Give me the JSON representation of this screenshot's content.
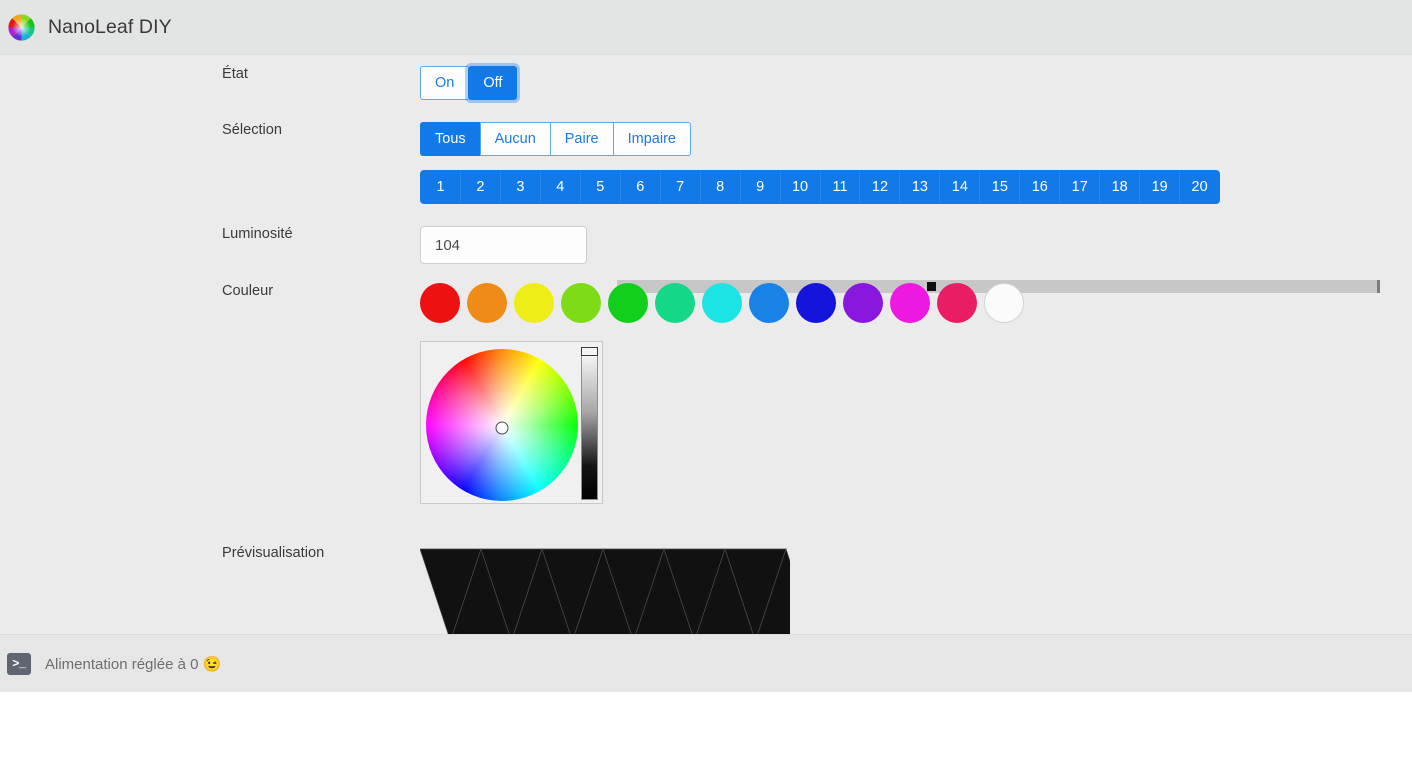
{
  "header": {
    "title": "NanoLeaf DIY",
    "logo_icon": "color-wheel-icon"
  },
  "rows": {
    "state": {
      "label": "État",
      "options": [
        {
          "label": "On",
          "active": false,
          "focused": false
        },
        {
          "label": "Off",
          "active": true,
          "focused": true
        }
      ]
    },
    "selection": {
      "label": "Sélection",
      "options": [
        {
          "label": "Tous",
          "active": true
        },
        {
          "label": "Aucun",
          "active": false
        },
        {
          "label": "Paire",
          "active": false
        },
        {
          "label": "Impaire",
          "active": false
        }
      ]
    },
    "panels": {
      "numbers": [
        "1",
        "2",
        "3",
        "4",
        "5",
        "6",
        "7",
        "8",
        "9",
        "10",
        "11",
        "12",
        "13",
        "14",
        "15",
        "16",
        "17",
        "18",
        "19",
        "20"
      ],
      "all_active": true
    },
    "brightness": {
      "label": "Luminosité",
      "value": "104",
      "placeholder": "",
      "slider": {
        "min": 0,
        "max": 255,
        "value": 104,
        "percent": 41
      }
    },
    "color": {
      "label": "Couleur",
      "swatches": [
        {
          "name": "red",
          "hex": "#ee1111"
        },
        {
          "name": "orange",
          "hex": "#ef8c19"
        },
        {
          "name": "yellow",
          "hex": "#eeee16"
        },
        {
          "name": "yellow-green",
          "hex": "#7ddc17"
        },
        {
          "name": "green",
          "hex": "#11cf1b"
        },
        {
          "name": "spring-green",
          "hex": "#14d888"
        },
        {
          "name": "cyan",
          "hex": "#1ce4e4"
        },
        {
          "name": "blue",
          "hex": "#1882e6"
        },
        {
          "name": "dark-blue",
          "hex": "#1414dd"
        },
        {
          "name": "purple",
          "hex": "#8a17dd"
        },
        {
          "name": "magenta",
          "hex": "#ee19e1"
        },
        {
          "name": "pink",
          "hex": "#ea1c65"
        },
        {
          "name": "none",
          "hex": ""
        }
      ],
      "picker": {
        "wheel_cursor": {
          "x_pct": 53,
          "y_pct": 51
        },
        "value_slider_position": "top"
      }
    },
    "preview": {
      "label": "Prévisualisation",
      "panel_count": 12,
      "panel_color": "#111111",
      "panel_edge": "#4a4a4a"
    }
  },
  "status": {
    "icon": "terminal-icon",
    "icon_glyph": ">_",
    "message": "Alimentation réglée à 0",
    "emoji": "😉"
  }
}
